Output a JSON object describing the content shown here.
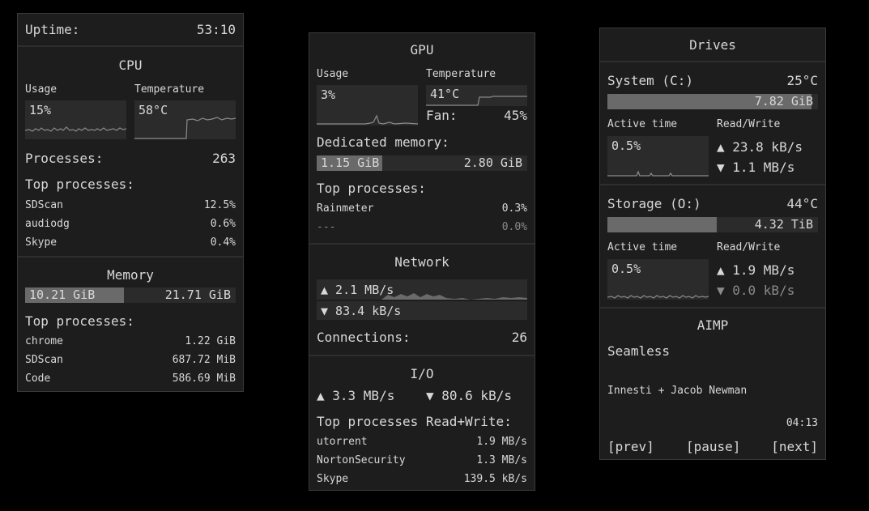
{
  "uptime": {
    "label": "Uptime:",
    "value": "53:10"
  },
  "cpu": {
    "title": "CPU",
    "usage_label": "Usage",
    "usage_value": "15%",
    "temp_label": "Temperature",
    "temp_value": "58°C",
    "processes_label": "Processes:",
    "processes_value": "263",
    "top_label": "Top processes:",
    "top": [
      {
        "name": "SDScan",
        "value": "12.5%"
      },
      {
        "name": "audiodg",
        "value": "0.6%"
      },
      {
        "name": "Skype",
        "value": "0.4%"
      }
    ]
  },
  "memory": {
    "title": "Memory",
    "used": "10.21 GiB",
    "total": "21.71 GiB",
    "fraction": 0.47,
    "top_label": "Top processes:",
    "top": [
      {
        "name": "chrome",
        "value": "1.22 GiB"
      },
      {
        "name": "SDScan",
        "value": "687.72 MiB"
      },
      {
        "name": "Code",
        "value": "586.69 MiB"
      }
    ]
  },
  "gpu": {
    "title": "GPU",
    "usage_label": "Usage",
    "usage_value": "3%",
    "temp_label": "Temperature",
    "temp_value": "41°C",
    "fan_label": "Fan:",
    "fan_value": "45%",
    "dedicated_label": "Dedicated memory:",
    "dedicated_used": "1.15 GiB",
    "dedicated_total": "2.80 GiB",
    "dedicated_fraction": 0.31,
    "top_label": "Top processes:",
    "top": [
      {
        "name": "Rainmeter",
        "value": "0.3%"
      },
      {
        "name": "---",
        "value": "0.0%"
      }
    ]
  },
  "network": {
    "title": "Network",
    "up": "▲ 2.1 MB/s",
    "down": "▼ 83.4 kB/s",
    "connections_label": "Connections:",
    "connections_value": "26"
  },
  "io": {
    "title": "I/O",
    "read": "▲ 3.3 MB/s",
    "write": "▼ 80.6 kB/s",
    "top_label": "Top processes Read+Write:",
    "top": [
      {
        "name": "utorrent",
        "value": "1.9 MB/s"
      },
      {
        "name": "NortonSecurity",
        "value": "1.3 MB/s"
      },
      {
        "name": "Skype",
        "value": "139.5 kB/s"
      }
    ]
  },
  "drives": {
    "title": "Drives",
    "list": [
      {
        "name": "System (C:)",
        "temp": "25°C",
        "free": "7.82 GiB",
        "fraction": 0.97,
        "active_label": "Active time",
        "active_value": "0.5%",
        "rw_label": "Read/Write",
        "read": "▲ 23.8 kB/s",
        "write": "▼ 1.1 MB/s"
      },
      {
        "name": "Storage (O:)",
        "temp": "44°C",
        "free": "4.32 TiB",
        "fraction": 0.52,
        "active_label": "Active time",
        "active_value": "0.5%",
        "rw_label": "Read/Write",
        "read": "▲ 1.9 MB/s",
        "write": "▼ 0.0 kB/s"
      }
    ]
  },
  "aimp": {
    "title": "AIMP",
    "track": "Seamless",
    "artist": "Innesti + Jacob Newman",
    "time": "04:13",
    "prev": "[prev]",
    "pause": "[pause]",
    "next": "[next]"
  },
  "colors": {
    "panel_bg": "#1d1d1d",
    "graph_bg": "#2b2b2b",
    "fill": "#6a6a6a",
    "text": "#d8d8d8",
    "dim": "#8a8a8a"
  }
}
